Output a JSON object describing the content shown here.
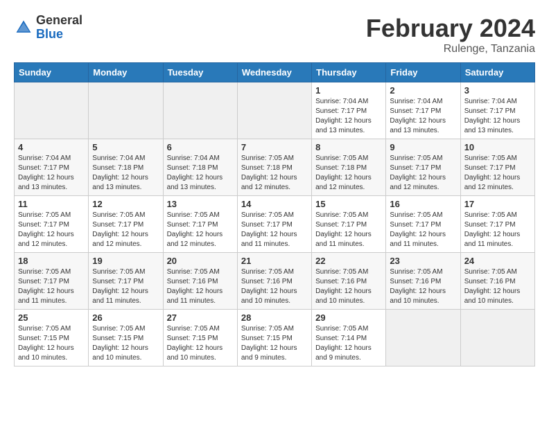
{
  "header": {
    "logo_general": "General",
    "logo_blue": "Blue",
    "month_title": "February 2024",
    "subtitle": "Rulenge, Tanzania"
  },
  "days_of_week": [
    "Sunday",
    "Monday",
    "Tuesday",
    "Wednesday",
    "Thursday",
    "Friday",
    "Saturday"
  ],
  "weeks": [
    [
      {
        "day": "",
        "detail": ""
      },
      {
        "day": "",
        "detail": ""
      },
      {
        "day": "",
        "detail": ""
      },
      {
        "day": "",
        "detail": ""
      },
      {
        "day": "1",
        "detail": "Sunrise: 7:04 AM\nSunset: 7:17 PM\nDaylight: 12 hours\nand 13 minutes."
      },
      {
        "day": "2",
        "detail": "Sunrise: 7:04 AM\nSunset: 7:17 PM\nDaylight: 12 hours\nand 13 minutes."
      },
      {
        "day": "3",
        "detail": "Sunrise: 7:04 AM\nSunset: 7:17 PM\nDaylight: 12 hours\nand 13 minutes."
      }
    ],
    [
      {
        "day": "4",
        "detail": "Sunrise: 7:04 AM\nSunset: 7:17 PM\nDaylight: 12 hours\nand 13 minutes."
      },
      {
        "day": "5",
        "detail": "Sunrise: 7:04 AM\nSunset: 7:18 PM\nDaylight: 12 hours\nand 13 minutes."
      },
      {
        "day": "6",
        "detail": "Sunrise: 7:04 AM\nSunset: 7:18 PM\nDaylight: 12 hours\nand 13 minutes."
      },
      {
        "day": "7",
        "detail": "Sunrise: 7:05 AM\nSunset: 7:18 PM\nDaylight: 12 hours\nand 12 minutes."
      },
      {
        "day": "8",
        "detail": "Sunrise: 7:05 AM\nSunset: 7:18 PM\nDaylight: 12 hours\nand 12 minutes."
      },
      {
        "day": "9",
        "detail": "Sunrise: 7:05 AM\nSunset: 7:17 PM\nDaylight: 12 hours\nand 12 minutes."
      },
      {
        "day": "10",
        "detail": "Sunrise: 7:05 AM\nSunset: 7:17 PM\nDaylight: 12 hours\nand 12 minutes."
      }
    ],
    [
      {
        "day": "11",
        "detail": "Sunrise: 7:05 AM\nSunset: 7:17 PM\nDaylight: 12 hours\nand 12 minutes."
      },
      {
        "day": "12",
        "detail": "Sunrise: 7:05 AM\nSunset: 7:17 PM\nDaylight: 12 hours\nand 12 minutes."
      },
      {
        "day": "13",
        "detail": "Sunrise: 7:05 AM\nSunset: 7:17 PM\nDaylight: 12 hours\nand 12 minutes."
      },
      {
        "day": "14",
        "detail": "Sunrise: 7:05 AM\nSunset: 7:17 PM\nDaylight: 12 hours\nand 11 minutes."
      },
      {
        "day": "15",
        "detail": "Sunrise: 7:05 AM\nSunset: 7:17 PM\nDaylight: 12 hours\nand 11 minutes."
      },
      {
        "day": "16",
        "detail": "Sunrise: 7:05 AM\nSunset: 7:17 PM\nDaylight: 12 hours\nand 11 minutes."
      },
      {
        "day": "17",
        "detail": "Sunrise: 7:05 AM\nSunset: 7:17 PM\nDaylight: 12 hours\nand 11 minutes."
      }
    ],
    [
      {
        "day": "18",
        "detail": "Sunrise: 7:05 AM\nSunset: 7:17 PM\nDaylight: 12 hours\nand 11 minutes."
      },
      {
        "day": "19",
        "detail": "Sunrise: 7:05 AM\nSunset: 7:17 PM\nDaylight: 12 hours\nand 11 minutes."
      },
      {
        "day": "20",
        "detail": "Sunrise: 7:05 AM\nSunset: 7:16 PM\nDaylight: 12 hours\nand 11 minutes."
      },
      {
        "day": "21",
        "detail": "Sunrise: 7:05 AM\nSunset: 7:16 PM\nDaylight: 12 hours\nand 10 minutes."
      },
      {
        "day": "22",
        "detail": "Sunrise: 7:05 AM\nSunset: 7:16 PM\nDaylight: 12 hours\nand 10 minutes."
      },
      {
        "day": "23",
        "detail": "Sunrise: 7:05 AM\nSunset: 7:16 PM\nDaylight: 12 hours\nand 10 minutes."
      },
      {
        "day": "24",
        "detail": "Sunrise: 7:05 AM\nSunset: 7:16 PM\nDaylight: 12 hours\nand 10 minutes."
      }
    ],
    [
      {
        "day": "25",
        "detail": "Sunrise: 7:05 AM\nSunset: 7:15 PM\nDaylight: 12 hours\nand 10 minutes."
      },
      {
        "day": "26",
        "detail": "Sunrise: 7:05 AM\nSunset: 7:15 PM\nDaylight: 12 hours\nand 10 minutes."
      },
      {
        "day": "27",
        "detail": "Sunrise: 7:05 AM\nSunset: 7:15 PM\nDaylight: 12 hours\nand 10 minutes."
      },
      {
        "day": "28",
        "detail": "Sunrise: 7:05 AM\nSunset: 7:15 PM\nDaylight: 12 hours\nand 9 minutes."
      },
      {
        "day": "29",
        "detail": "Sunrise: 7:05 AM\nSunset: 7:14 PM\nDaylight: 12 hours\nand 9 minutes."
      },
      {
        "day": "",
        "detail": ""
      },
      {
        "day": "",
        "detail": ""
      }
    ]
  ]
}
